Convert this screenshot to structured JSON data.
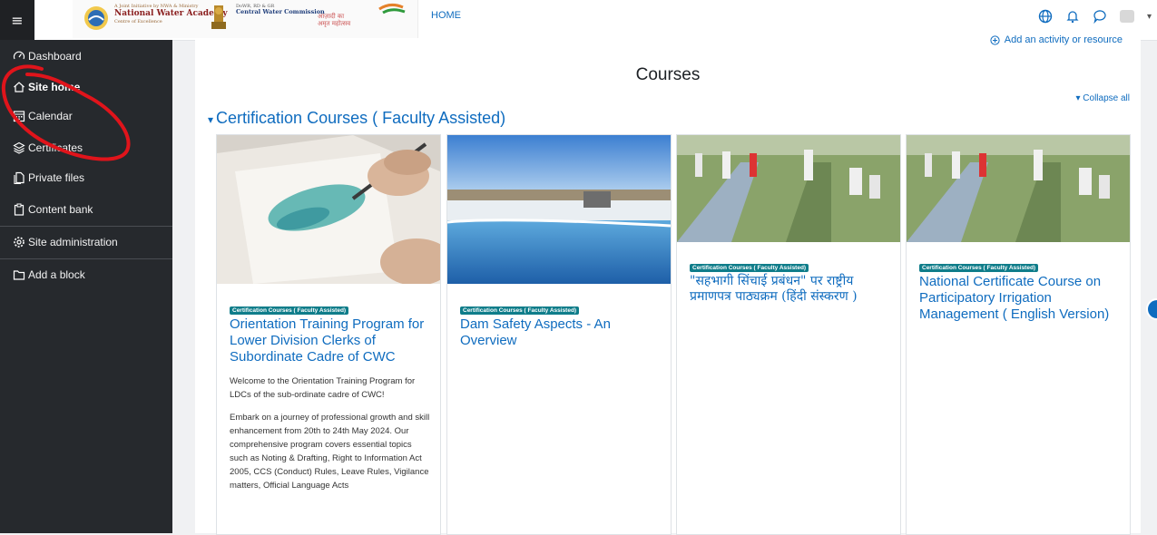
{
  "header": {
    "logo1_small": "A Joint Initiative by NWA & Ministry",
    "logo1_title": "National Water Academy",
    "logo1_sub": "Centre of Excellence",
    "logo2_small": "DoWR, RD & GR",
    "logo2_title": "Central Water Commission",
    "azadi_line1": "आज़ादी का",
    "azadi_line2": "अमृत महोत्सव",
    "nav_home": "HOME"
  },
  "sidebar": {
    "menu_icon": "hamburger-icon",
    "items": [
      {
        "label": "Dashboard",
        "icon": "gauge-icon"
      },
      {
        "label": "Site home",
        "icon": "home-icon"
      },
      {
        "label": "Calendar",
        "icon": "calendar-icon"
      },
      {
        "label": "Certificates",
        "icon": "layers-icon"
      },
      {
        "label": "Private files",
        "icon": "files-icon"
      },
      {
        "label": "Content bank",
        "icon": "clipboard-icon"
      },
      {
        "label": "Site administration",
        "icon": "gear-icon"
      },
      {
        "label": "Add a block",
        "icon": "folder-icon"
      }
    ]
  },
  "main": {
    "add_activity": "Add an activity or resource",
    "page_title": "Courses",
    "collapse_all": "Collapse all",
    "section_title": "Certification Courses ( Faculty Assisted)",
    "courses": [
      {
        "category": "Certification Courses ( Faculty Assisted)",
        "title": "Orientation Training Program for Lower Division Clerks of Subordinate Cadre of CWC",
        "summary_1": "Welcome to the Orientation Training Program for LDCs of the sub-ordinate cadre of CWC!",
        "summary_2": "Embark on a journey of professional growth and skill enhancement from 20th to 24th May 2024. Our comprehensive program covers essential topics such as Noting & Drafting, Right to Information Act 2005, CCS (Conduct) Rules, Leave Rules, Vigilance matters, Official Language Acts"
      },
      {
        "category": "Certification Courses ( Faculty Assisted)",
        "title": "Dam Safety Aspects - An Overview"
      },
      {
        "category": "Certification Courses ( Faculty Assisted)",
        "title": "\"सहभागी सिंचाई प्रबंधन\" पर राष्ट्रीय प्रमाणपत्र पाठ्यक्रम (हिंदी संस्करण )"
      },
      {
        "category": "Certification Courses ( Faculty Assisted)",
        "title": "National Certificate Course on Participatory Irrigation Management ( English Version)"
      }
    ]
  },
  "colors": {
    "sidebar_bg": "#26292d",
    "link_blue": "#0f6cbf",
    "badge_teal": "#0f7d8a",
    "annotation_red": "#e0141b"
  }
}
